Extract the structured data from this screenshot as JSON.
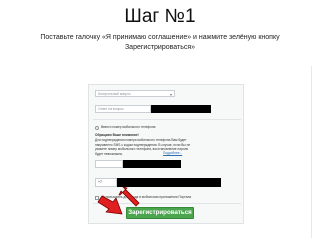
{
  "slide": {
    "title": "Шаг №1",
    "instruction": "Поставьте галочку «Я принимаю соглашение» и нажмите зелёную кнопку Зарегистрироваться»"
  },
  "form": {
    "account_select": "Контрольный вопрос",
    "answer_placeholder": "Ответ на вопрос",
    "phone_label": "Ввести номер мобильного телефона",
    "phone_hint_title": "Обращаем Ваше внимание!",
    "phone_hint_text": "Для подтверждения номера мобильного телефона Вам будет направлено SMS с кодом подтверждения. В случае, если Вы не укажете номер мобильного телефона, восстановление пароля будет невозможно.",
    "phone_hint_link": "Подробнее...",
    "country_code": "+7",
    "app_login_label": "Использовать для входа в мобильном приложении Портала",
    "agree_label": "Я принимаю",
    "agree_link": "соглашение",
    "register_label": "Зарегистрироваться"
  },
  "colors": {
    "register_button": "#4aa54e",
    "arrow": "#e02020",
    "link": "#2b6db3"
  },
  "icons": {
    "select_arrow": "chevron-down-icon",
    "pointer_arrows": "red-arrow-icon"
  }
}
